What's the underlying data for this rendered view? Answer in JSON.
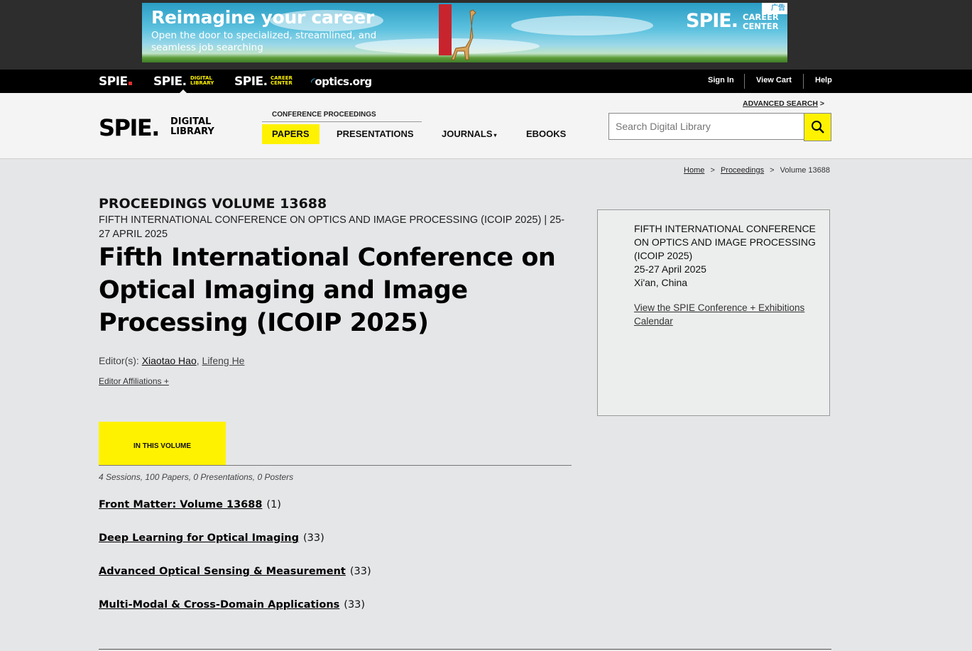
{
  "ad": {
    "headline": "Reimagine your career",
    "subtext": "Open the door to specialized, streamlined, and seamless job searching",
    "brand": "SPIE.",
    "brand_sub": "CAREER CENTER",
    "badge": "广告"
  },
  "topnav": {
    "spie": "SPIE.",
    "digital_library": "SPIE.",
    "digital_library_sub1": "DIGITAL",
    "digital_library_sub2": "LIBRARY",
    "career_center": "SPIE.",
    "career_center_sub1": "CAREER",
    "career_center_sub2": "CENTER",
    "optics": "optics.org",
    "sign_in": "Sign In",
    "view_cart": "View Cart",
    "help": "Help"
  },
  "header": {
    "logo_spie": "SPIE.",
    "logo_sub1": "DIGITAL",
    "logo_sub2": "LIBRARY",
    "conf_label": "CONFERENCE PROCEEDINGS",
    "nav": {
      "papers": "PAPERS",
      "presentations": "PRESENTATIONS",
      "journals": "JOURNALS",
      "ebooks": "EBOOKS"
    },
    "advanced_search": "ADVANCED SEARCH",
    "search_placeholder": "Search Digital Library"
  },
  "breadcrumb": {
    "home": "Home",
    "proceedings": "Proceedings",
    "current": "Volume 13688"
  },
  "main": {
    "eyebrow": "PROCEEDINGS VOLUME 13688",
    "conf_sub": "FIFTH INTERNATIONAL CONFERENCE ON OPTICS AND IMAGE PROCESSING (ICOIP 2025) | 25-27 APRIL 2025",
    "title": "Fifth International Conference on Optical Imaging and Image Processing (ICOIP 2025)",
    "editors_label": "Editor(s):",
    "editor1": "Xiaotao Hao",
    "editor2": "Lifeng He",
    "affiliations": "Editor Affiliations +",
    "tab": "IN THIS VOLUME",
    "counts": "4 Sessions, 100 Papers, 0 Presentations, 0 Posters",
    "sessions": [
      {
        "title": "Front Matter: Volume 13688",
        "count": "(1)"
      },
      {
        "title": "Deep Learning for Optical Imaging",
        "count": "(33)"
      },
      {
        "title": "Advanced Optical Sensing & Measurement",
        "count": "(33)"
      },
      {
        "title": "Multi-Modal & Cross-Domain Applications",
        "count": "(33)"
      }
    ]
  },
  "sidebar": {
    "line1": "FIFTH INTERNATIONAL CONFERENCE ON OPTICS AND IMAGE PROCESSING (ICOIP 2025)",
    "dates": "25-27 April 2025",
    "location": "Xi'an, China",
    "calendar_link": "View the SPIE Conference + Exhibitions Calendar"
  }
}
